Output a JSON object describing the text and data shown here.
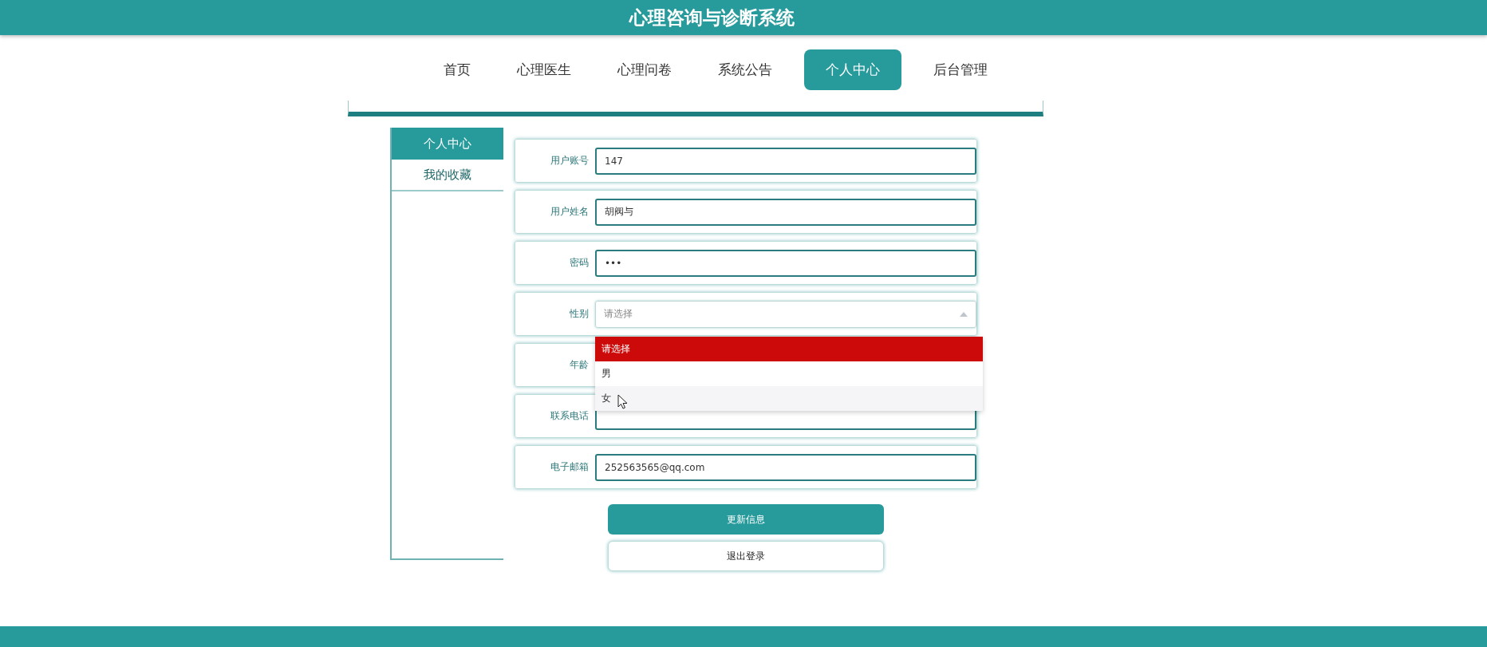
{
  "header": {
    "title": "心理咨询与诊断系统"
  },
  "nav": [
    {
      "label": "首页",
      "selected": false
    },
    {
      "label": "心理医生",
      "selected": false
    },
    {
      "label": "心理问卷",
      "selected": false
    },
    {
      "label": "系统公告",
      "selected": false
    },
    {
      "label": "个人中心",
      "selected": true
    },
    {
      "label": "后台管理",
      "selected": false
    }
  ],
  "sidebar": {
    "title": "个人中心",
    "items": [
      {
        "label": "我的收藏",
        "selected": false
      }
    ]
  },
  "form": {
    "fields": [
      {
        "kind": "input",
        "label": "用户账号",
        "value": "147"
      },
      {
        "kind": "input",
        "label": "用户姓名",
        "value": "胡阀与"
      },
      {
        "kind": "input",
        "label": "密码",
        "value": "•••"
      },
      {
        "kind": "select",
        "label": "性别",
        "placeholder": "请选择",
        "expanded": true,
        "options": [
          {
            "label": "请选择",
            "selected": true,
            "hovered": false
          },
          {
            "label": "男",
            "selected": false,
            "hovered": false
          },
          {
            "label": "女",
            "selected": false,
            "hovered": true
          }
        ]
      },
      {
        "kind": "covered",
        "label": "年龄"
      },
      {
        "kind": "input",
        "label": "联系电话"
      },
      {
        "kind": "input",
        "label": "电子邮箱",
        "value": "252563565@qq.com"
      }
    ],
    "buttons": [
      {
        "kind": "primary",
        "label": "更新信息"
      },
      {
        "kind": "secondary",
        "label": "退出登录"
      }
    ]
  }
}
